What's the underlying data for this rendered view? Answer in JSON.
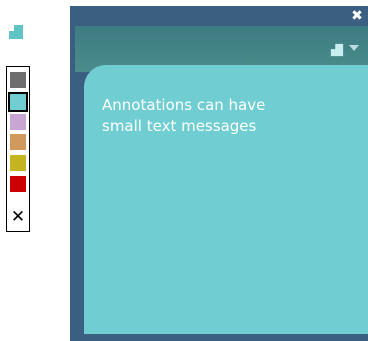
{
  "toolbar": {
    "tool_icon": "annotation-tool-icon",
    "tool_color": "#5ec4c4"
  },
  "palette": {
    "colors": [
      {
        "name": "dark-gray",
        "hex": "#6e6e6e",
        "selected": false
      },
      {
        "name": "teal",
        "hex": "#70cdd1",
        "selected": true
      },
      {
        "name": "lavender",
        "hex": "#c7a6d3",
        "selected": false
      },
      {
        "name": "tan",
        "hex": "#d2995f",
        "selected": false
      },
      {
        "name": "olive",
        "hex": "#c4b420",
        "selected": false
      },
      {
        "name": "red",
        "hex": "#cc0000",
        "selected": false
      }
    ],
    "clear_icon": "close-icon",
    "clear_glyph": "✕"
  },
  "annotation": {
    "close_glyph": "✖",
    "header_icon": "annotation-icon",
    "menu_icon": "chevron-down-icon",
    "text": "Annotations can have\nsmall text messages",
    "frame_color": "#3b5f80",
    "header_color": "#4a8c8c",
    "body_color": "#70cdd1"
  }
}
